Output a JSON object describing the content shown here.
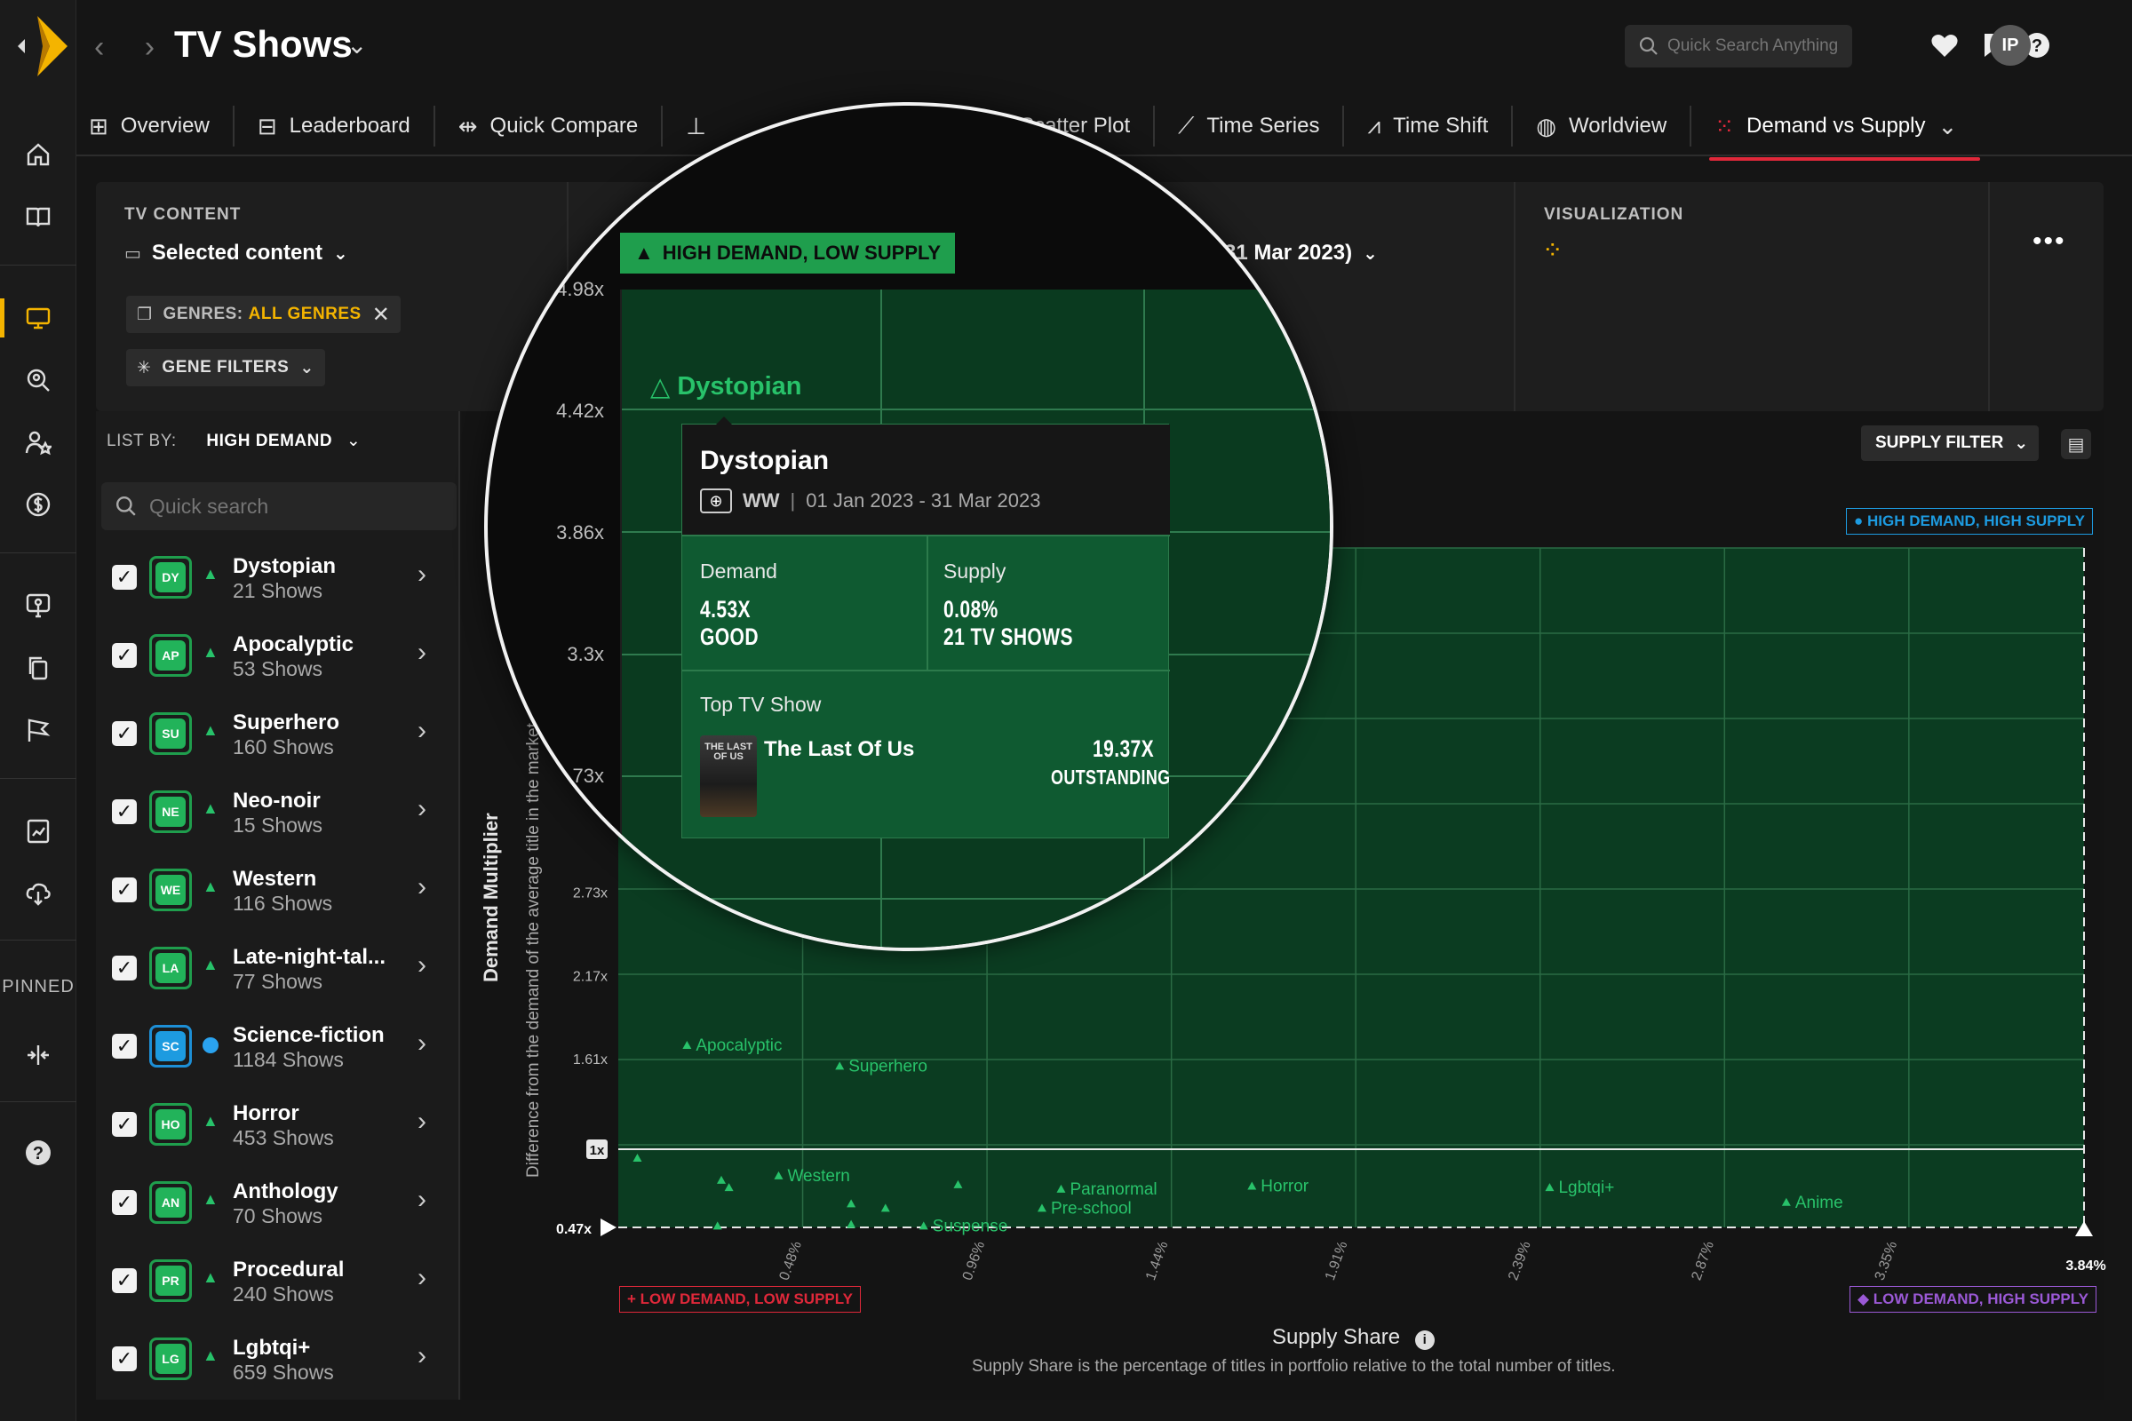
{
  "app": {
    "title": "TV Shows"
  },
  "search": {
    "placeholder": "Quick Search Anything"
  },
  "user": {
    "initials": "IP"
  },
  "tabs": [
    {
      "label": "Overview",
      "icon": "grid-icon"
    },
    {
      "label": "Leaderboard",
      "icon": "table-icon"
    },
    {
      "label": "Quick Compare",
      "icon": "compare-icon"
    },
    {
      "label": "",
      "icon": "chart-icon"
    },
    {
      "label": "Scatter Plot",
      "icon": "scatter-icon"
    },
    {
      "label": "Time Series",
      "icon": "line-chart-icon"
    },
    {
      "label": "Time Shift",
      "icon": "time-shift-icon"
    },
    {
      "label": "Worldview",
      "icon": "globe-icon"
    },
    {
      "label": "Demand vs Supply",
      "icon": "demand-supply-icon",
      "active": true
    }
  ],
  "filters": {
    "tv_content_label": "TV CONTENT",
    "selected_content": "Selected content",
    "genres_label": "GENRES:",
    "genres_value": "ALL GENRES",
    "gene_filters": "GENE FILTERS",
    "date_range": "31 Mar 2023)",
    "visualization_label": "VISUALIZATION"
  },
  "list": {
    "list_by_label": "LIST BY:",
    "list_by_value": "HIGH DEMAND",
    "search_placeholder": "Quick search",
    "items": [
      {
        "code": "DY",
        "name": "Dystopian",
        "count": "21 Shows",
        "trend": "up"
      },
      {
        "code": "AP",
        "name": "Apocalyptic",
        "count": "53 Shows",
        "trend": "up"
      },
      {
        "code": "SU",
        "name": "Superhero",
        "count": "160 Shows",
        "trend": "up"
      },
      {
        "code": "NE",
        "name": "Neo-noir",
        "count": "15 Shows",
        "trend": "up"
      },
      {
        "code": "WE",
        "name": "Western",
        "count": "116 Shows",
        "trend": "up"
      },
      {
        "code": "LA",
        "name": "Late-night-tal...",
        "count": "77 Shows",
        "trend": "up"
      },
      {
        "code": "SC",
        "name": "Science-fiction",
        "count": "1184 Shows",
        "trend": "dot"
      },
      {
        "code": "HO",
        "name": "Horror",
        "count": "453 Shows",
        "trend": "up"
      },
      {
        "code": "AN",
        "name": "Anthology",
        "count": "70 Shows",
        "trend": "up"
      },
      {
        "code": "PR",
        "name": "Procedural",
        "count": "240 Shows",
        "trend": "up"
      },
      {
        "code": "LG",
        "name": "Lgbtqi+",
        "count": "659 Shows",
        "trend": "up"
      }
    ]
  },
  "chart": {
    "supply_filter": "SUPPLY FILTER",
    "quadrants": {
      "hh": "HIGH DEMAND, HIGH SUPPLY",
      "hl": "HIGH DEMAND, LOW SUPPLY",
      "ll": "LOW DEMAND, LOW SUPPLY",
      "lh": "LOW DEMAND, HIGH SUPPLY"
    },
    "colors": {
      "hh": "#1d9be0",
      "hl": "#1f9e4d",
      "ll": "#e0283a",
      "lh": "#9b59d6",
      "plot": "#0b3c21",
      "point": "#28c26a"
    },
    "ylabel": "Demand Multiplier",
    "ylabel_sub": "Difference from the demand of the average title in the market. (1x)",
    "xlabel": "Supply Share",
    "xlabel_sub": "Supply Share is the percentage of titles in portfolio relative to the total number of titles.",
    "y_min_label": "0.47x",
    "y_one_label": "1x",
    "x_max_label": "3.84%",
    "y_ticks_small": [
      "2.73x",
      "2.17x",
      "1.61x"
    ],
    "x_ticks": [
      "0.48%",
      "0.96%",
      "1.44%",
      "1.91%",
      "2.39%",
      "2.87%",
      "3.35%"
    ],
    "zoom_y_ticks": [
      "4.98x",
      "4.42x",
      "3.86x",
      "3.3x",
      "2.73x"
    ],
    "zoom_dystopian_label": "Dystopian",
    "point_labels": [
      "Apocalyptic",
      "Superhero",
      "Western",
      "Paranormal",
      "Pre-school",
      "Suspense",
      "Horror",
      "Lgbtqi+",
      "Anime",
      "Dystopian"
    ]
  },
  "chart_data": {
    "type": "scatter",
    "xlabel": "Supply Share",
    "ylabel": "Demand Multiplier",
    "x_ticks": [
      "0.48%",
      "0.96%",
      "1.44%",
      "1.91%",
      "2.39%",
      "2.87%",
      "3.35%"
    ],
    "y_ticks": [
      "1x",
      "1.61x",
      "2.17x",
      "2.73x",
      "3.3x",
      "3.86x",
      "4.42x",
      "4.98x"
    ],
    "xlim": [
      0,
      3.84
    ],
    "ylim": [
      0.47,
      4.98
    ],
    "points": [
      {
        "name": "Dystopian",
        "x": 0.08,
        "y": 4.53
      },
      {
        "name": "Apocalyptic",
        "x": 0.18,
        "y": 1.7
      },
      {
        "name": "Superhero",
        "x": 0.58,
        "y": 1.56
      },
      {
        "name": "Western",
        "x": 0.42,
        "y": 0.82
      },
      {
        "name": "Paranormal",
        "x": 1.16,
        "y": 0.73
      },
      {
        "name": "Pre-school",
        "x": 1.11,
        "y": 0.6
      },
      {
        "name": "Suspense",
        "x": 0.8,
        "y": 0.48
      },
      {
        "name": "Horror",
        "x": 1.66,
        "y": 0.75
      },
      {
        "name": "Lgbtqi+",
        "x": 2.44,
        "y": 0.74
      },
      {
        "name": "Anime",
        "x": 3.06,
        "y": 0.64
      },
      {
        "name": "",
        "x": 0.05,
        "y": 0.94
      },
      {
        "name": "",
        "x": 0.27,
        "y": 0.79
      },
      {
        "name": "",
        "x": 0.29,
        "y": 0.74
      },
      {
        "name": "",
        "x": 0.61,
        "y": 0.63
      },
      {
        "name": "",
        "x": 0.7,
        "y": 0.6
      },
      {
        "name": "",
        "x": 0.89,
        "y": 0.76
      },
      {
        "name": "",
        "x": 0.26,
        "y": 0.48
      },
      {
        "name": "",
        "x": 0.61,
        "y": 0.49
      }
    ]
  },
  "tooltip": {
    "title": "Dystopian",
    "region": "WW",
    "dates": "01 Jan 2023 - 31 Mar 2023",
    "demand_label": "Demand",
    "demand_value": "4.53X",
    "demand_rating": "GOOD",
    "supply_label": "Supply",
    "supply_value": "0.08%",
    "supply_count": "21 TV SHOWS",
    "top_label": "Top TV Show",
    "top_show": "The Last Of Us",
    "top_value": "19.37X",
    "top_rating": "OUTSTANDING",
    "poster_text": "THE LAST OF US"
  },
  "rail": {
    "pinned_label": "PINNED"
  }
}
